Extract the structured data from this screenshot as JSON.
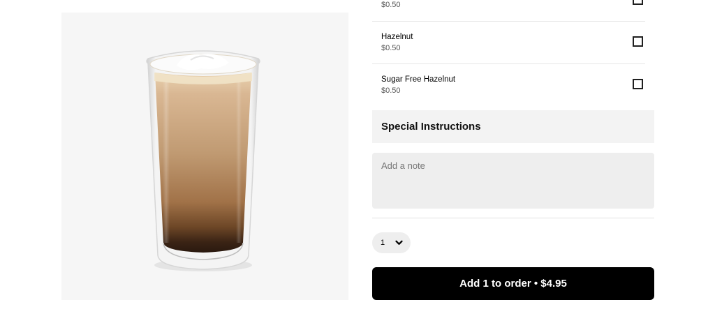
{
  "options": [
    {
      "name": "",
      "price": "$0.50"
    },
    {
      "name": "Hazelnut",
      "price": "$0.50"
    },
    {
      "name": "Sugar Free Hazelnut",
      "price": "$0.50"
    }
  ],
  "special_instructions": {
    "title": "Special Instructions",
    "placeholder": "Add a note"
  },
  "quantity": {
    "value": "1",
    "icon": "chevron-down-icon"
  },
  "add_button": {
    "label": "Add 1 to order • $4.95"
  },
  "product_image": {
    "icon": "latte-glass-image"
  },
  "colors": {
    "button_bg": "#000000",
    "panel_bg": "#f3f3f3",
    "input_bg": "#eeeeee"
  }
}
